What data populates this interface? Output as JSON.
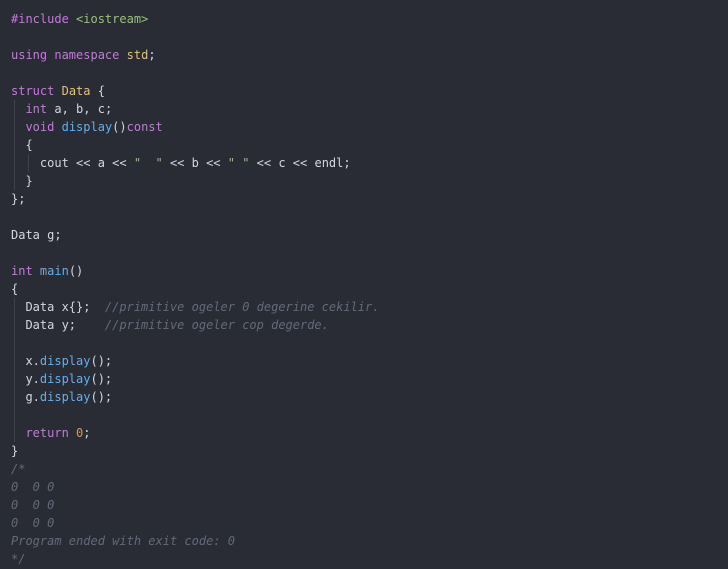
{
  "code_lines": [
    [
      {
        "t": "#include",
        "c": "pp"
      },
      {
        "t": " ",
        "c": "pl"
      },
      {
        "t": "<iostream>",
        "c": "inc"
      }
    ],
    [],
    [
      {
        "t": "using",
        "c": "kw"
      },
      {
        "t": " ",
        "c": "pl"
      },
      {
        "t": "namespace",
        "c": "kw"
      },
      {
        "t": " ",
        "c": "pl"
      },
      {
        "t": "std",
        "c": "ns"
      },
      {
        "t": ";",
        "c": "pl"
      }
    ],
    [],
    [
      {
        "t": "struct",
        "c": "kw"
      },
      {
        "t": " ",
        "c": "pl"
      },
      {
        "t": "Data",
        "c": "cls"
      },
      {
        "t": " {",
        "c": "pl"
      }
    ],
    [
      {
        "t": "  ",
        "c": "pl"
      },
      {
        "t": "int",
        "c": "ty"
      },
      {
        "t": " a, b, c;",
        "c": "pl"
      }
    ],
    [
      {
        "t": "  ",
        "c": "pl"
      },
      {
        "t": "void",
        "c": "ty"
      },
      {
        "t": " ",
        "c": "pl"
      },
      {
        "t": "display",
        "c": "fn"
      },
      {
        "t": "()",
        "c": "pl"
      },
      {
        "t": "const",
        "c": "kw"
      }
    ],
    [
      {
        "t": "  {",
        "c": "pl"
      }
    ],
    [
      {
        "t": "    cout << a << ",
        "c": "pl"
      },
      {
        "t": "\"  \"",
        "c": "str"
      },
      {
        "t": " << b << ",
        "c": "pl"
      },
      {
        "t": "\" \"",
        "c": "str"
      },
      {
        "t": " << c << endl;",
        "c": "pl"
      }
    ],
    [
      {
        "t": "  }",
        "c": "pl"
      }
    ],
    [
      {
        "t": "};",
        "c": "pl"
      }
    ],
    [],
    [
      {
        "t": "Data g;",
        "c": "pl"
      }
    ],
    [],
    [
      {
        "t": "int",
        "c": "ty"
      },
      {
        "t": " ",
        "c": "pl"
      },
      {
        "t": "main",
        "c": "fn"
      },
      {
        "t": "()",
        "c": "pl"
      }
    ],
    [
      {
        "t": "{",
        "c": "pl"
      }
    ],
    [
      {
        "t": "  Data x{};  ",
        "c": "pl"
      },
      {
        "t": "//primitive ogeler 0 degerine cekilir.",
        "c": "cm"
      }
    ],
    [
      {
        "t": "  Data y;    ",
        "c": "pl"
      },
      {
        "t": "//primitive ogeler cop degerde.",
        "c": "cm"
      }
    ],
    [],
    [
      {
        "t": "  x.",
        "c": "pl"
      },
      {
        "t": "display",
        "c": "fn"
      },
      {
        "t": "();",
        "c": "pl"
      }
    ],
    [
      {
        "t": "  y.",
        "c": "pl"
      },
      {
        "t": "display",
        "c": "fn"
      },
      {
        "t": "();",
        "c": "pl"
      }
    ],
    [
      {
        "t": "  g.",
        "c": "pl"
      },
      {
        "t": "display",
        "c": "fn"
      },
      {
        "t": "();",
        "c": "pl"
      }
    ],
    [],
    [
      {
        "t": "  ",
        "c": "pl"
      },
      {
        "t": "return",
        "c": "kw"
      },
      {
        "t": " ",
        "c": "pl"
      },
      {
        "t": "0",
        "c": "num"
      },
      {
        "t": ";",
        "c": "pl"
      }
    ],
    [
      {
        "t": "}",
        "c": "pl"
      }
    ],
    [
      {
        "t": "/*",
        "c": "cm"
      }
    ],
    [
      {
        "t": "0  0 0",
        "c": "cm"
      }
    ],
    [
      {
        "t": "0  0 0",
        "c": "cm"
      }
    ],
    [
      {
        "t": "0  0 0",
        "c": "cm"
      }
    ],
    [
      {
        "t": "Program ended with exit code: 0",
        "c": "cm"
      }
    ],
    [
      {
        "t": "*/",
        "c": "cm"
      }
    ]
  ],
  "colors": {
    "background": "#292b35",
    "keyword": "#c678dd",
    "type_name": "#e5c07b",
    "function": "#61afef",
    "string": "#98c379",
    "number": "#d19a66",
    "comment": "#636a7a",
    "plain": "#d4d7dd"
  }
}
